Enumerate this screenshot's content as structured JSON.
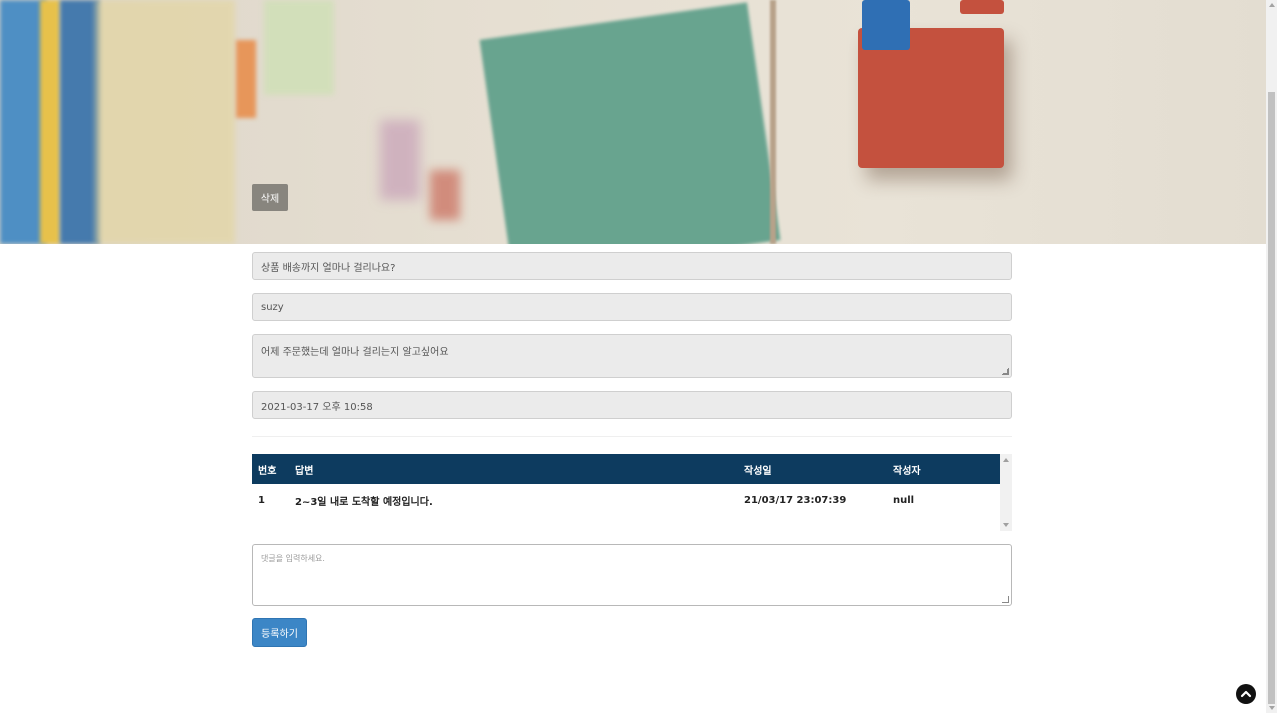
{
  "hero": {
    "delete_label": "삭제"
  },
  "post": {
    "title": "상품 배송까지 얼마나 걸리나요?",
    "author": "suzy",
    "content": "어제 주문했는데 얼마나 걸리는지 알고싶어요",
    "date": "2021-03-17 오후 10:58"
  },
  "replies": {
    "headers": {
      "no": "번호",
      "answer": "답변",
      "date": "작성일",
      "writer": "작성자"
    },
    "rows": [
      {
        "no": "1",
        "answer": "2~3일 내로 도착할 예정입니다.",
        "date": "21/03/17 23:07:39",
        "writer": "null"
      }
    ]
  },
  "comment": {
    "placeholder": "댓글을 입력하세요.",
    "submit_label": "등록하기"
  },
  "icons": {
    "scroll_top": "chevron-up-circle-icon"
  },
  "colors": {
    "table_header": "#0d3b5f",
    "submit_button": "#3c86c6"
  }
}
